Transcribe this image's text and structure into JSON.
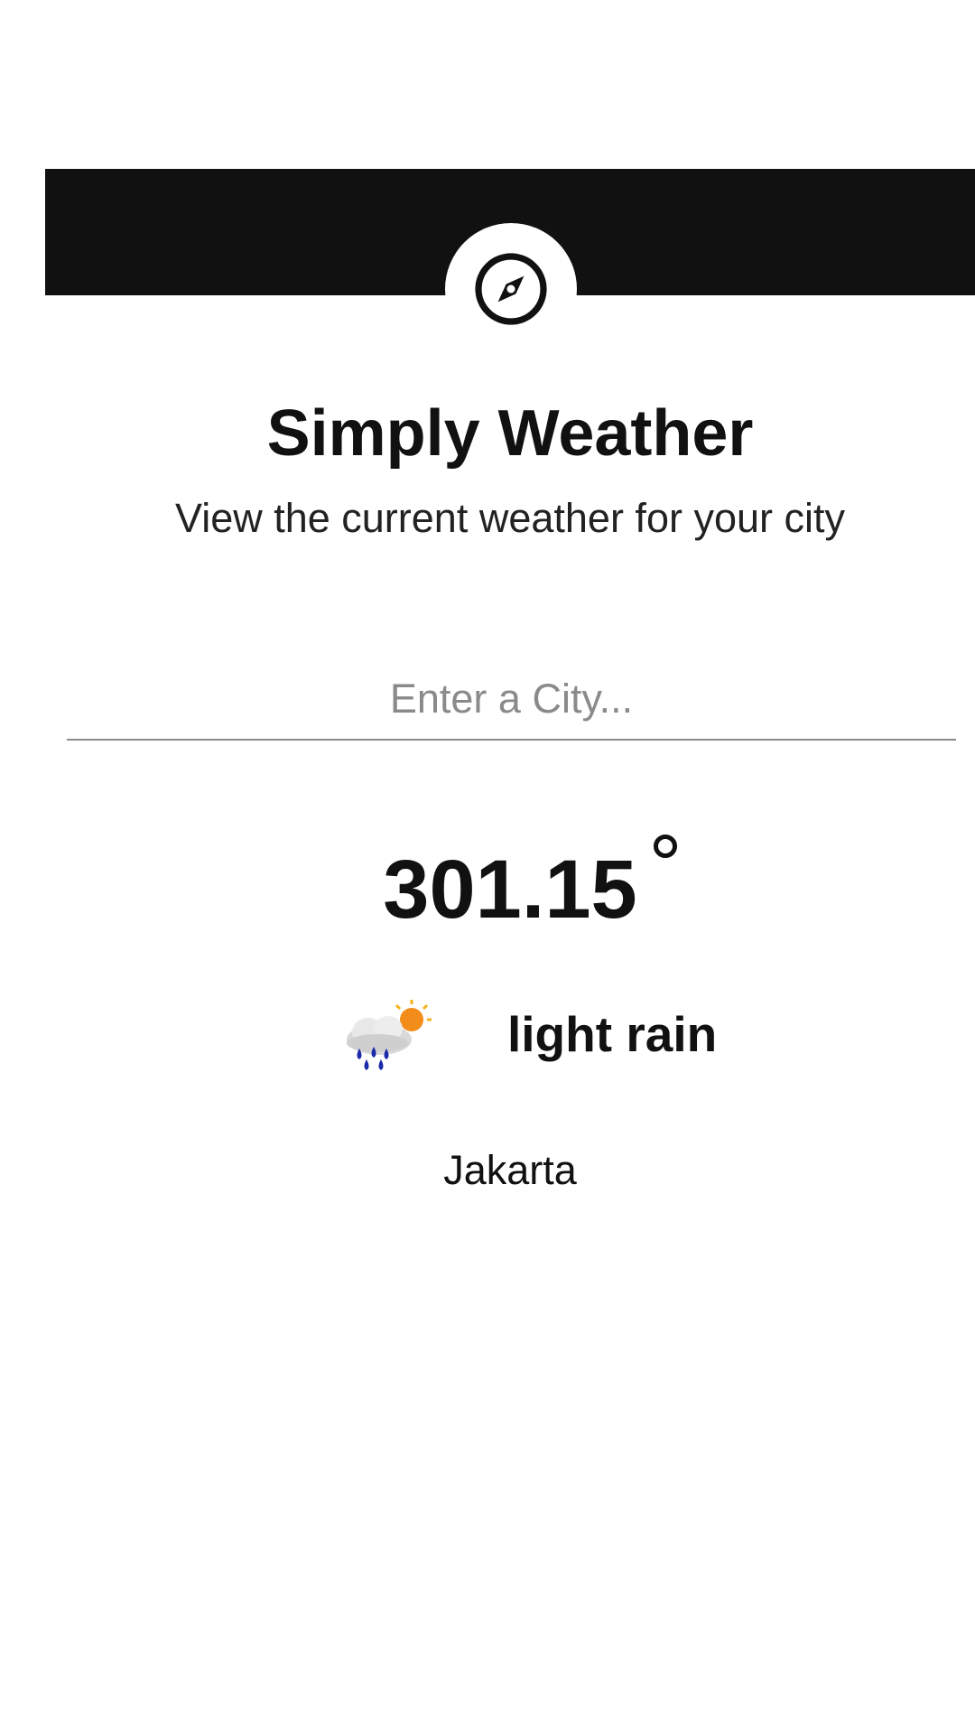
{
  "app": {
    "title": "Simply Weather",
    "subtitle": "View the current weather for your city",
    "logo_icon": "compass-icon"
  },
  "search": {
    "placeholder": "Enter a City...",
    "value": ""
  },
  "weather": {
    "temperature": "301.15",
    "degree_symbol": "°",
    "condition": "light rain",
    "condition_icon": "light-rain-partly-sunny-icon",
    "city": "Jakarta"
  },
  "colors": {
    "header": "#111111",
    "background": "#ffffff",
    "text": "#111111",
    "divider": "#8a8a8a",
    "rain": "#1a2aa8",
    "sun": "#f28c1a"
  }
}
